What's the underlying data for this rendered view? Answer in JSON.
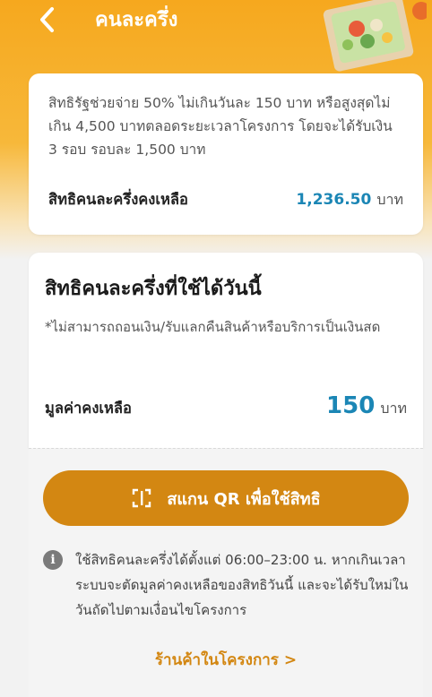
{
  "header": {
    "title": "คนละครึ่ง",
    "back_icon": "chevron-left-icon"
  },
  "summary": {
    "description": "สิทธิรัฐช่วยจ่าย 50% ไม่เกินวันละ 150 บาท หรือสูงสุดไม่เกิน 4,500 บาทตลอดระยะเวลาโครงการ โดยจะได้รับเงิน 3 รอบ รอบละ 1,500 บาท",
    "remain_label": "สิทธิคนละครึ่งคงเหลือ",
    "remain_amount": "1,236.50",
    "unit": "บาท"
  },
  "today": {
    "heading": "สิทธิคนละครึ่งที่ใช้ได้วันนี้",
    "note": "*ไม่สามารถถอนเงิน/รับแลกคืนสินค้าหรือบริการเป็นเงินสด",
    "value_label": "มูลค่าคงเหลือ",
    "value": "150",
    "unit": "บาท"
  },
  "actions": {
    "scan_label": "สแกน QR เพื่อใช้สิทธิ",
    "info_text": "ใช้สิทธิคนละครึ่งได้ตั้งแต่ 06:00–23:00 น. หากเกินเวลา ระบบจะตัดมูลค่าคงเหลือของสิทธิวันนี้ และจะได้รับใหม่ในวันถัดไปตามเงื่อนไขโครงการ",
    "shop_link": "ร้านค้าในโครงการ >"
  },
  "colors": {
    "brand_orange": "#f6a81e",
    "button": "#d38712",
    "accent_blue": "#1b86b5"
  }
}
